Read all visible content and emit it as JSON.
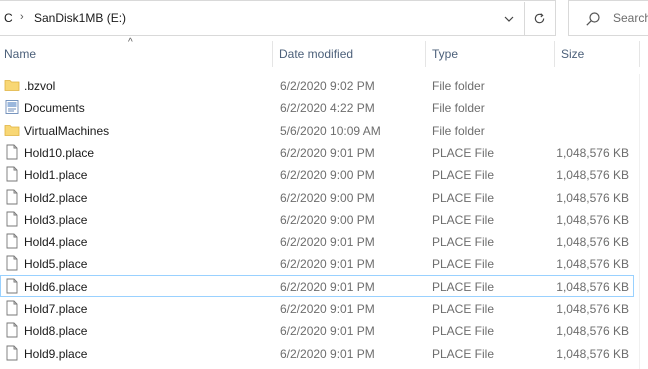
{
  "address": {
    "prefix": "C",
    "path_label": "SanDisk1MB (E:)"
  },
  "search": {
    "placeholder": "Search"
  },
  "columns": {
    "name": "Name",
    "date": "Date modified",
    "type": "Type",
    "size": "Size"
  },
  "files": [
    {
      "name": ".bzvol",
      "date": "6/2/2020 9:02 PM",
      "type": "File folder",
      "size": "",
      "icon": "folder-icon"
    },
    {
      "name": "Documents",
      "date": "6/2/2020 4:22 PM",
      "type": "File folder",
      "size": "",
      "icon": "documents-folder-icon"
    },
    {
      "name": "VirtualMachines",
      "date": "5/6/2020 10:09 AM",
      "type": "File folder",
      "size": "",
      "icon": "folder-icon"
    },
    {
      "name": "Hold10.place",
      "date": "6/2/2020 9:01 PM",
      "type": "PLACE File",
      "size": "1,048,576 KB",
      "icon": "file-icon"
    },
    {
      "name": "Hold1.place",
      "date": "6/2/2020 9:00 PM",
      "type": "PLACE File",
      "size": "1,048,576 KB",
      "icon": "file-icon"
    },
    {
      "name": "Hold2.place",
      "date": "6/2/2020 9:00 PM",
      "type": "PLACE File",
      "size": "1,048,576 KB",
      "icon": "file-icon"
    },
    {
      "name": "Hold3.place",
      "date": "6/2/2020 9:00 PM",
      "type": "PLACE File",
      "size": "1,048,576 KB",
      "icon": "file-icon"
    },
    {
      "name": "Hold4.place",
      "date": "6/2/2020 9:01 PM",
      "type": "PLACE File",
      "size": "1,048,576 KB",
      "icon": "file-icon"
    },
    {
      "name": "Hold5.place",
      "date": "6/2/2020 9:01 PM",
      "type": "PLACE File",
      "size": "1,048,576 KB",
      "icon": "file-icon"
    },
    {
      "name": "Hold6.place",
      "date": "6/2/2020 9:01 PM",
      "type": "PLACE File",
      "size": "1,048,576 KB",
      "icon": "file-icon",
      "selected": true
    },
    {
      "name": "Hold7.place",
      "date": "6/2/2020 9:01 PM",
      "type": "PLACE File",
      "size": "1,048,576 KB",
      "icon": "file-icon"
    },
    {
      "name": "Hold8.place",
      "date": "6/2/2020 9:01 PM",
      "type": "PLACE File",
      "size": "1,048,576 KB",
      "icon": "file-icon"
    },
    {
      "name": "Hold9.place",
      "date": "6/2/2020 9:01 PM",
      "type": "PLACE File",
      "size": "1,048,576 KB",
      "icon": "file-icon"
    }
  ],
  "colors": {
    "header_text": "#4c607a",
    "meta_text": "#6d6d6d",
    "folder": "#f8d775",
    "selection_border": "#99d1ff"
  }
}
